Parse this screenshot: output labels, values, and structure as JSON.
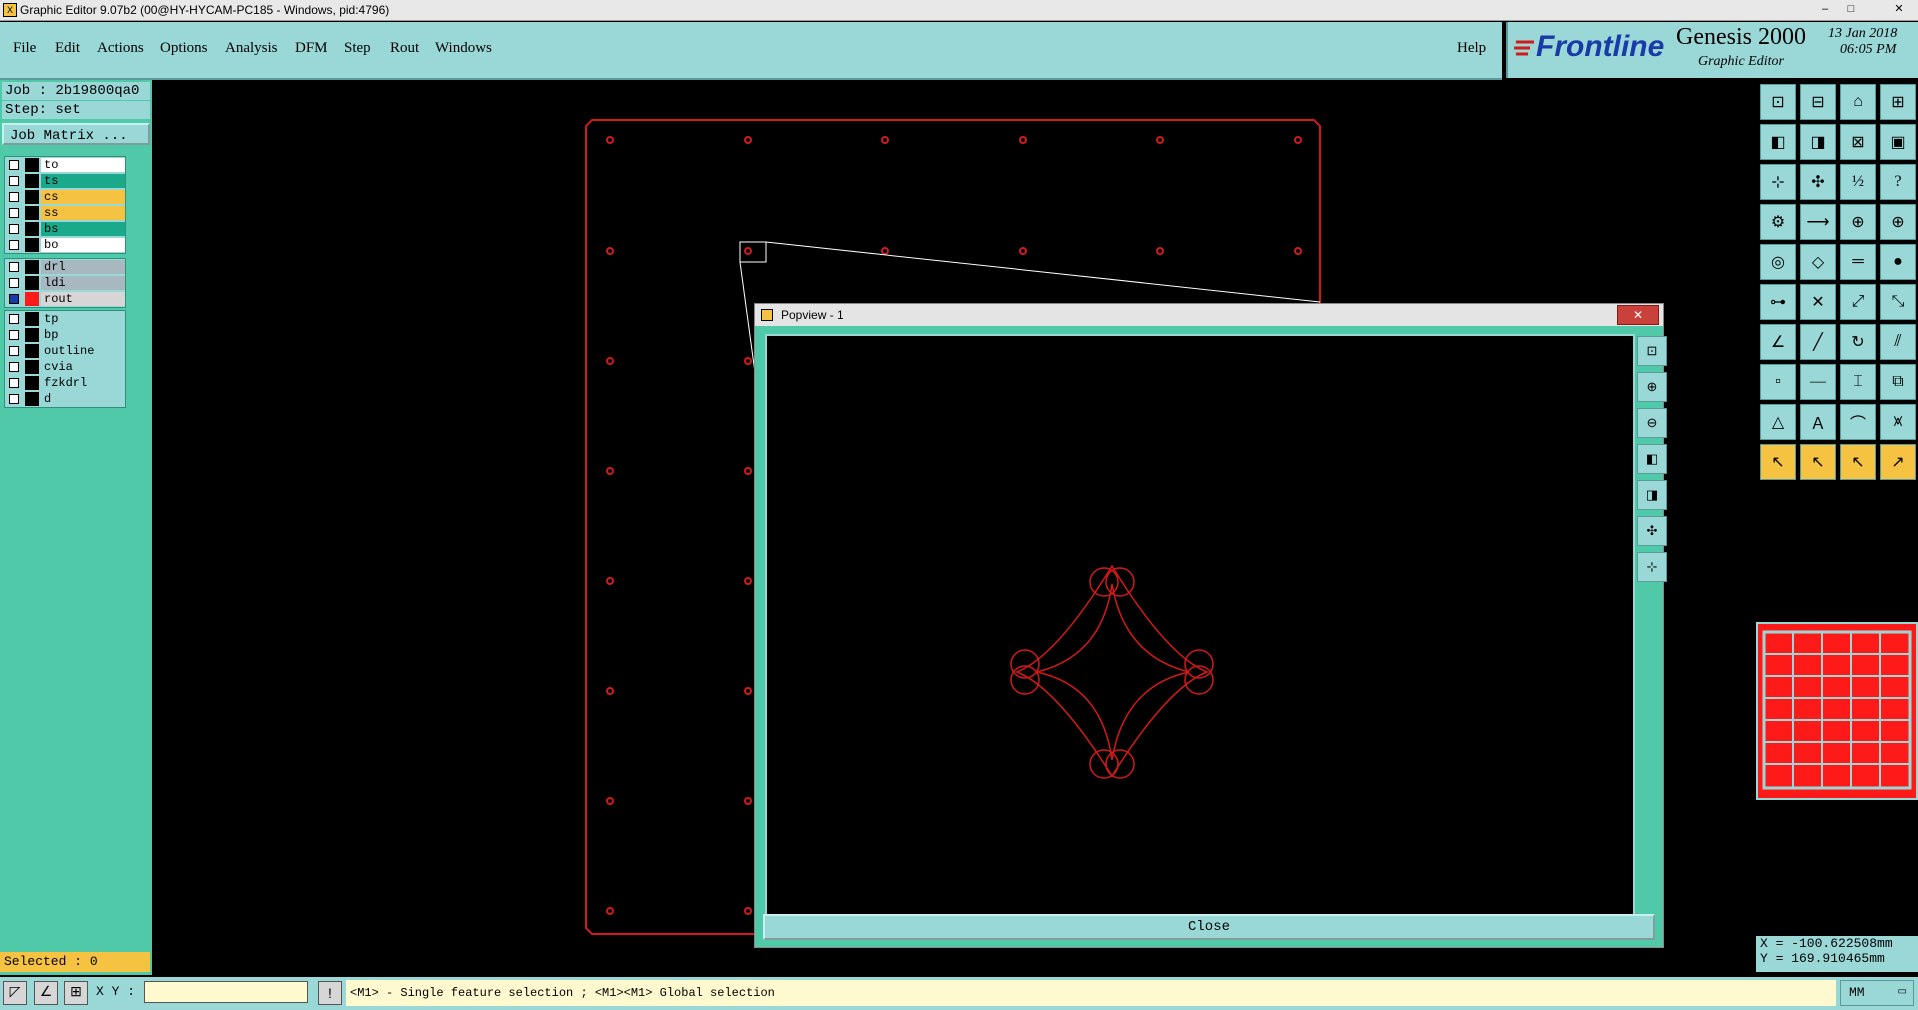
{
  "window": {
    "title": "Graphic Editor 9.07b2 (00@HY-HYCAM-PC185 - Windows, pid:4796)",
    "controls": [
      "–",
      "□",
      "✕"
    ]
  },
  "menubar": {
    "items": [
      "File",
      "Edit",
      "Actions",
      "Options",
      "Analysis",
      "DFM",
      "Step",
      "Rout",
      "Windows"
    ],
    "help": "Help"
  },
  "brand": {
    "logo": "Frontline",
    "product": "Genesis 2000",
    "subtitle": "Graphic Editor",
    "date": "13 Jan 2018",
    "time": "06:05 PM"
  },
  "job": {
    "job": "Job : 2b19800qa0",
    "step": "Step: set",
    "matrix_button": "Job Matrix ..."
  },
  "layer_groups": [
    [
      {
        "name": "to",
        "color": "#ffffff"
      },
      {
        "name": "ts",
        "color": "#1aa98a"
      },
      {
        "name": "cs",
        "color": "#f5c242"
      },
      {
        "name": "ss",
        "color": "#f5c242"
      },
      {
        "name": "bs",
        "color": "#1aa98a"
      },
      {
        "name": "bo",
        "color": "#ffffff"
      }
    ],
    [
      {
        "name": "drl",
        "color": "#a8b8c0"
      },
      {
        "name": "ldi",
        "color": "#a8b8c0"
      },
      {
        "name": "rout",
        "color": "#d6d6d6",
        "active": true
      }
    ],
    [
      {
        "name": "tp",
        "color": "#9ad8d8"
      },
      {
        "name": "bp",
        "color": "#9ad8d8"
      },
      {
        "name": "outline",
        "color": "#9ad8d8"
      },
      {
        "name": "cvia",
        "color": "#9ad8d8"
      },
      {
        "name": "fzkdrl",
        "color": "#9ad8d8"
      },
      {
        "name": "d",
        "color": "#9ad8d8"
      }
    ]
  ],
  "selected": "Selected : 0",
  "status": {
    "xy_label": "X Y :",
    "xy_value": "",
    "info_icon": "!",
    "message": "<M1> - Single feature selection ; <M1><M1> Global selection",
    "units": "MM"
  },
  "coords": {
    "x": "X = -100.622508mm",
    "y": "Y = 169.910465mm"
  },
  "popview": {
    "title": "Popview - 1",
    "close": "Close"
  },
  "toolbar_icons": [
    "zoom-home-icon",
    "zoom-in-icon",
    "home-icon",
    "window-icon",
    "pan-left-icon",
    "pan-right-icon",
    "zoom-fit-icon",
    "zoom-box-icon",
    "fit-icon",
    "center-icon",
    "scale-1-2-icon",
    "help-icon",
    "snap-icon",
    "measure-icon",
    "layer-red-icon",
    "layer-blue-icon",
    "pad-icon",
    "line-icon",
    "ruler-icon",
    "circle-icon",
    "node-icon",
    "cross-icon",
    "connect-icon",
    "route-icon",
    "angle-icon",
    "slash-icon",
    "arc-icon",
    "trim-icon",
    "move-icon",
    "minus-icon",
    "bracket-icon",
    "symbol-icon",
    "triangle-icon",
    "a-icon",
    "bridge-icon",
    "arch-icon",
    "select-icon",
    "select2-icon",
    "select3-icon",
    "select4-icon"
  ],
  "colors": {
    "board": "#d21a1a",
    "panel": "#9ad8d8",
    "teal": "#4fc9a7",
    "red": "#ff1a1a"
  }
}
